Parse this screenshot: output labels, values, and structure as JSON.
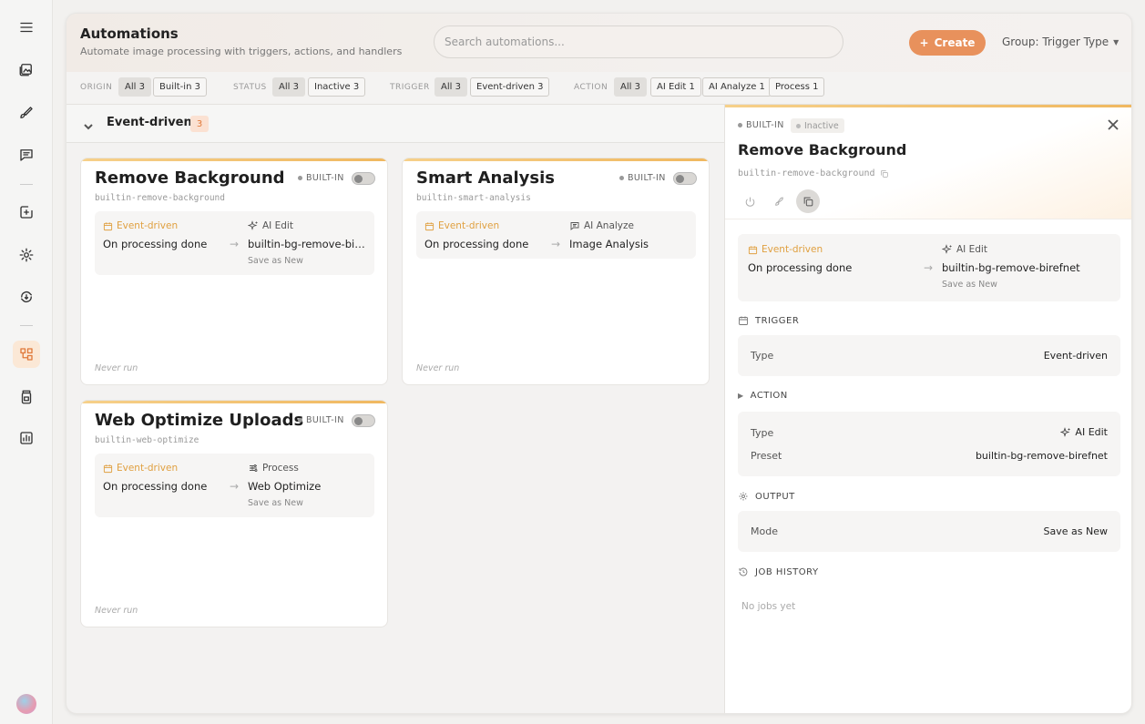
{
  "colors": {
    "accent": "#e8915c",
    "trigger": "#e0a040",
    "gradient_top": "#f0b860"
  },
  "sidebar": {
    "items": [
      {
        "name": "menu-icon"
      },
      {
        "name": "gallery-icon"
      },
      {
        "name": "brush-icon"
      },
      {
        "name": "chat-icon"
      },
      {
        "name": "import-icon"
      },
      {
        "name": "settings-gear-icon"
      },
      {
        "name": "sync-icon"
      },
      {
        "name": "automations-icon",
        "active": true
      },
      {
        "name": "jar-icon"
      },
      {
        "name": "stats-icon"
      }
    ]
  },
  "header": {
    "title": "Automations",
    "subtitle": "Automate image processing with triggers, actions, and handlers",
    "search_placeholder": "Search automations...",
    "create_label": "Create",
    "group_label": "Group: Trigger Type"
  },
  "filters": {
    "origin": {
      "label": "ORIGIN",
      "chips": [
        "All 3",
        "Built-in 3"
      ]
    },
    "status": {
      "label": "STATUS",
      "chips": [
        "All 3",
        "Inactive 3"
      ]
    },
    "trigger": {
      "label": "TRIGGER",
      "chips": [
        "All 3",
        "Event-driven 3"
      ]
    },
    "action": {
      "label": "ACTION",
      "chips": [
        "All 3",
        "AI Edit 1",
        "AI Analyze 1",
        "Process 1"
      ]
    }
  },
  "group": {
    "title": "Event-driven",
    "count": "3"
  },
  "cards": [
    {
      "title": "Remove Background",
      "slug": "builtin-remove-background",
      "badge": "BUILT-IN",
      "trigger_type": "Event-driven",
      "trigger_value": "On processing done",
      "action_type": "AI Edit",
      "action_value": "builtin-bg-remove-birefnet",
      "output": "Save as New",
      "last_run": "Never run"
    },
    {
      "title": "Smart Analysis",
      "slug": "builtin-smart-analysis",
      "badge": "BUILT-IN",
      "trigger_type": "Event-driven",
      "trigger_value": "On processing done",
      "action_type": "AI Analyze",
      "action_value": "Image Analysis",
      "output": "",
      "last_run": "Never run"
    },
    {
      "title": "Web Optimize Uploads",
      "slug": "builtin-web-optimize",
      "badge": "BUILT-IN",
      "trigger_type": "Event-driven",
      "trigger_value": "On processing done",
      "action_type": "Process",
      "action_value": "Web Optimize",
      "output": "Save as New",
      "last_run": "Never run"
    }
  ],
  "detail": {
    "badge_builtin": "BUILT-IN",
    "badge_status": "Inactive",
    "title": "Remove Background",
    "slug": "builtin-remove-background",
    "flow": {
      "trigger_type": "Event-driven",
      "trigger_value": "On processing done",
      "action_type": "AI Edit",
      "action_value": "builtin-bg-remove-birefnet",
      "output": "Save as New"
    },
    "trigger_section": "TRIGGER",
    "trigger_type_key": "Type",
    "trigger_type_val": "Event-driven",
    "action_section": "ACTION",
    "action_type_key": "Type",
    "action_type_val": "AI Edit",
    "action_preset_key": "Preset",
    "action_preset_val": "builtin-bg-remove-birefnet",
    "output_section": "OUTPUT",
    "output_mode_key": "Mode",
    "output_mode_val": "Save as New",
    "history_section": "JOB HISTORY",
    "history_empty": "No jobs yet"
  }
}
